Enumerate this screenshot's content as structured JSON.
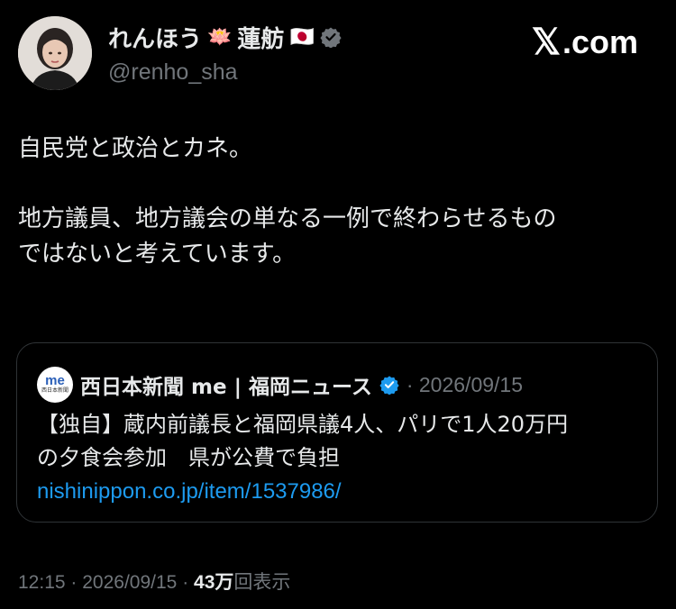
{
  "author": {
    "display_name": "れんほう",
    "display_name_suffix": "蓮舫",
    "lotus_emoji": "🪷",
    "flag_emoji": "🇯🇵",
    "handle": "@renho_sha",
    "avatar_icon": "profile-photo"
  },
  "brand": {
    "mark": "𝕏",
    "text": ".com"
  },
  "tweet": {
    "line1": "自民党と政治とカネ。",
    "line2": "地方議員、地方議会の単なる一例で終わらせるもの",
    "line3": "ではないと考えています。"
  },
  "quote": {
    "logo_text": "me",
    "logo_subtext": "西日本新聞",
    "source_name": "西日本新聞 me | 福岡ニュース",
    "date": "· 2026/09/15",
    "body_line1": "【独自】蔵内前議長と福岡県議4人、パリで1人20万円",
    "body_line2": "の夕食会参加　県が公費で負担",
    "link": "nishinippon.co.jp/item/1537986/"
  },
  "footer": {
    "time": "12:15",
    "date": "2026/09/15",
    "sep": "·",
    "views_num": "43万",
    "views_label": "回表示"
  },
  "colors": {
    "accent": "#1d9bf0",
    "background": "#000000",
    "muted": "#71767b"
  }
}
